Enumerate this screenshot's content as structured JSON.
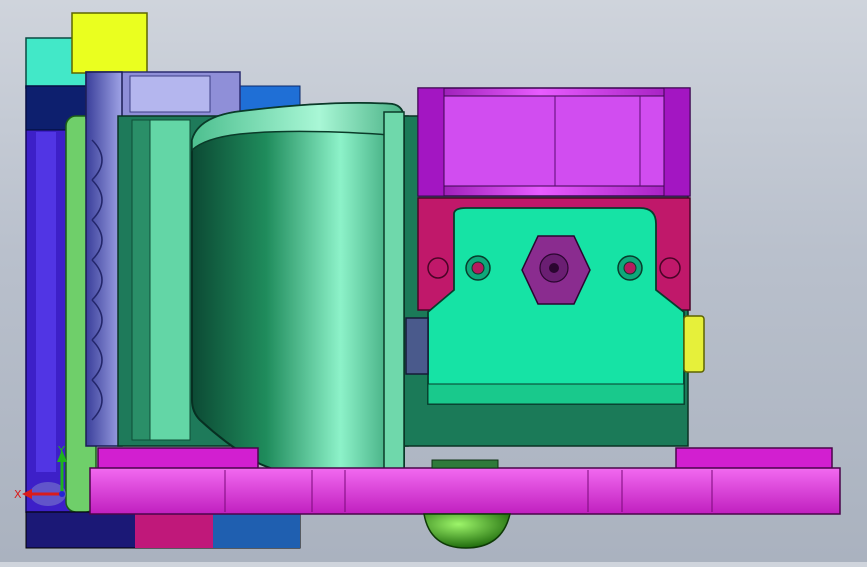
{
  "viewport": {
    "background_top": "#cfd4dc",
    "background_bottom": "#aab2bf"
  },
  "parts": [
    {
      "name": "yellow-block",
      "color": "#eaff1f"
    },
    {
      "name": "cyan-plate",
      "color": "#42e8c8"
    },
    {
      "name": "blue-plate",
      "color": "#3d20c8"
    },
    {
      "name": "navy-bracket",
      "color": "#0d1f6e"
    },
    {
      "name": "blower-fan",
      "color": "#8f8fd8"
    },
    {
      "name": "duct-shroud",
      "color": "#1e9a63"
    },
    {
      "name": "hotend-block",
      "color": "#16e3a5"
    },
    {
      "name": "heater-mount",
      "color": "#c0186a"
    },
    {
      "name": "top-fan",
      "color": "#c524e3"
    },
    {
      "name": "base-plate",
      "color": "#e623e2"
    },
    {
      "name": "nozzle-ball",
      "color": "#2f9b14"
    },
    {
      "name": "yellow-pin",
      "color": "#e6f03a"
    },
    {
      "name": "slate-pin",
      "color": "#4a5a8c"
    }
  ],
  "triad": {
    "x_label": "X",
    "y_label": "Y",
    "x_color": "#d91c1c",
    "y_color": "#1fb21f",
    "z_color": "#2424d6"
  }
}
